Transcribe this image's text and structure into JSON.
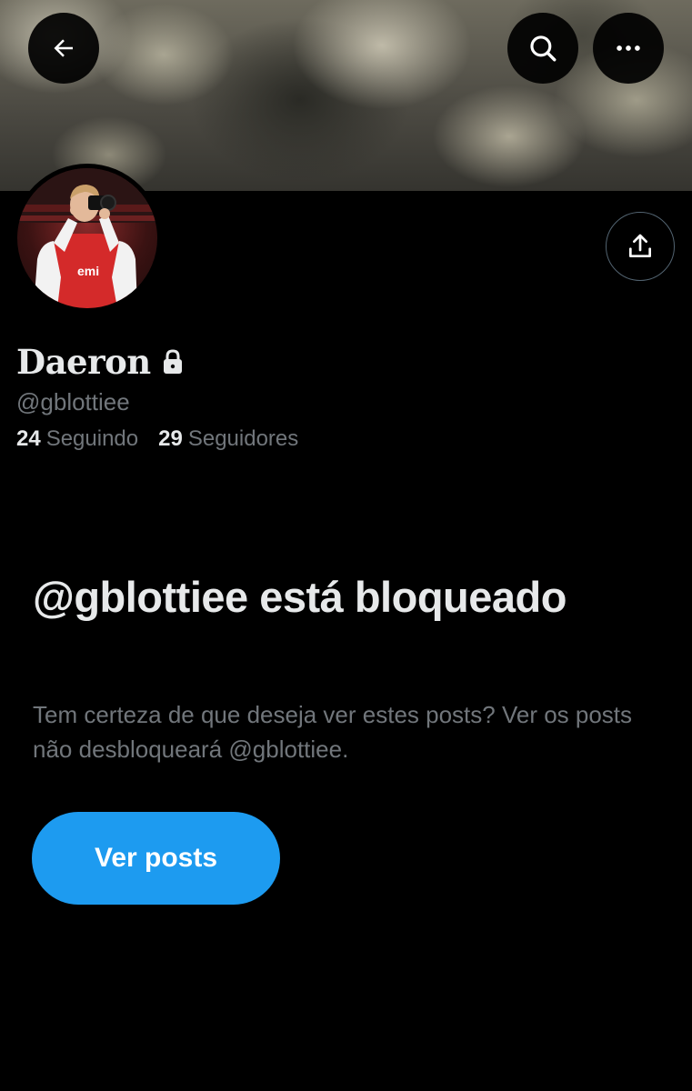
{
  "header": {
    "back_icon": "arrow-left-icon",
    "search_icon": "search-icon",
    "more_icon": "more-horizontal-icon"
  },
  "profile": {
    "display_name": "Daeron",
    "protected_icon": "lock-icon",
    "handle": "@gblottiee",
    "following_count": "24",
    "following_label": "Seguindo",
    "followers_count": "29",
    "followers_label": "Seguidores",
    "share_icon": "share-upload-icon"
  },
  "blocked_notice": {
    "title": "@gblottiee está bloqueado",
    "description": "Tem certeza de que deseja ver estes posts? Ver os posts não desbloqueará @gblottiee.",
    "button_label": "Ver posts"
  },
  "colors": {
    "background": "#000000",
    "primary_text": "#e7e9ea",
    "secondary_text": "#71767b",
    "accent": "#1d9bf0"
  }
}
